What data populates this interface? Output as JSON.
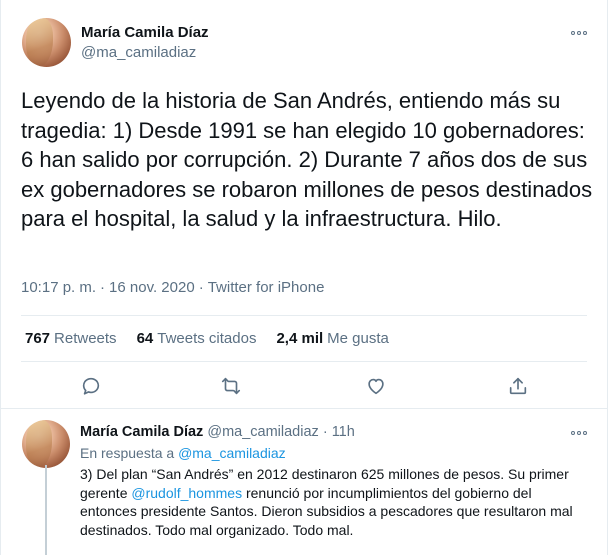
{
  "main_tweet": {
    "author_name": "María Camila Díaz",
    "author_handle": "@ma_camiladiaz",
    "text": "Leyendo de la historia de San Andrés, entiendo más su tragedia: 1) Desde 1991 se han elegido 10 gobernadores: 6 han salido por corrupción. 2) Durante 7 años dos de sus ex gobernadores se robaron millones de pesos destinados para el hospital, la salud y la infraestructura. Hilo.",
    "time": "10:17 p. m.",
    "date": "16 nov. 2020",
    "separator": "·",
    "source": "Twitter for iPhone",
    "stats": {
      "retweets_count": "767",
      "retweets_label": "Retweets",
      "quotes_count": "64",
      "quotes_label": "Tweets citados",
      "likes_count": "2,4 mil",
      "likes_label": "Me gusta"
    }
  },
  "reply_tweet": {
    "author_name": "María Camila Díaz",
    "author_handle": "@ma_camiladiaz",
    "separator": "·",
    "time_ago": "11h",
    "reply_prefix": "En respuesta a",
    "reply_handle": "@ma_camiladiaz",
    "text_part1": "3) Del plan “San Andrés” en 2012 destinaron 625 millones de pesos. Su primer gerente ",
    "mention": "@rudolf_hommes",
    "text_part2": " renunció por incumplimientos del gobierno del entonces presidente Santos. Dieron subsidios a pescadores que resultaron mal destinados. Todo mal organizado. Todo mal."
  },
  "icons": {
    "reply": "reply-icon",
    "retweet": "retweet-icon",
    "like": "heart-icon",
    "share": "share-icon",
    "more": "more-icon"
  },
  "colors": {
    "link": "#1b95e0",
    "secondary_text": "#5b7083",
    "primary_text": "#0f1419",
    "divider": "#e6ecf0"
  }
}
